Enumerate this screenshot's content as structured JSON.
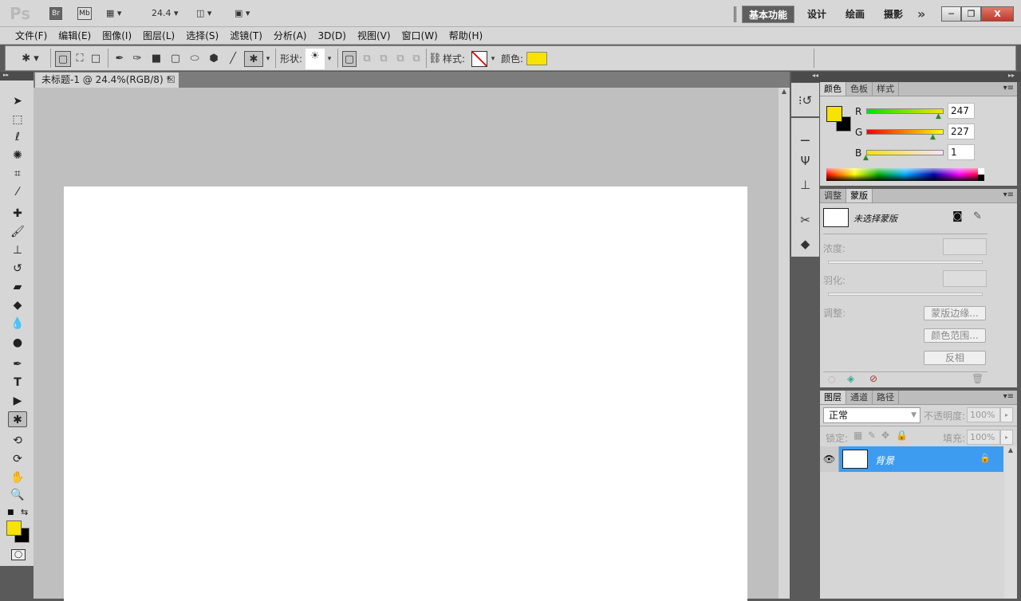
{
  "app": {
    "logo": "Ps",
    "bridge": "Br",
    "mini_bridge": "Mb",
    "zoom": "24.4"
  },
  "workspaces": [
    "基本功能",
    "设计",
    "绘画",
    "摄影"
  ],
  "workspace_more": "»",
  "window_controls": {
    "minimize": "─",
    "restore": "❐",
    "close": "X"
  },
  "menu": [
    "文件(F)",
    "编辑(E)",
    "图像(I)",
    "图层(L)",
    "选择(S)",
    "滤镜(T)",
    "分析(A)",
    "3D(D)",
    "视图(V)",
    "窗口(W)",
    "帮助(H)"
  ],
  "options": {
    "shape_label": "形状:",
    "style_label": "样式:",
    "color_label": "颜色:",
    "color": "#f7e301"
  },
  "document": {
    "tab_title": "未标题-1 @ 24.4%(RGB/8) *",
    "close": "☒"
  },
  "colors": {
    "foreground": "#f7e301",
    "background": "#000000"
  },
  "color_panel": {
    "tabs": [
      "颜色",
      "色板",
      "样式"
    ],
    "channels": [
      {
        "label": "R",
        "value": "247",
        "fraction": 0.969
      },
      {
        "label": "G",
        "value": "227",
        "fraction": 0.89
      },
      {
        "label": "B",
        "value": "1",
        "fraction": 0.004
      }
    ]
  },
  "masks_panel": {
    "tabs": [
      "调整",
      "蒙版"
    ],
    "status": "未选择蒙版",
    "density_label": "浓度:",
    "feather_label": "羽化:",
    "refine_label": "调整:",
    "buttons": [
      "蒙版边缘...",
      "颜色范围...",
      "反相"
    ]
  },
  "layers_panel": {
    "tabs": [
      "图层",
      "通道",
      "路径"
    ],
    "blend_mode": "正常",
    "opacity_label": "不透明度:",
    "opacity": "100%",
    "lock_label": "锁定:",
    "fill_label": "填充:",
    "fill": "100%",
    "layers": [
      {
        "name": "背景",
        "locked": true,
        "visible": true
      }
    ]
  }
}
